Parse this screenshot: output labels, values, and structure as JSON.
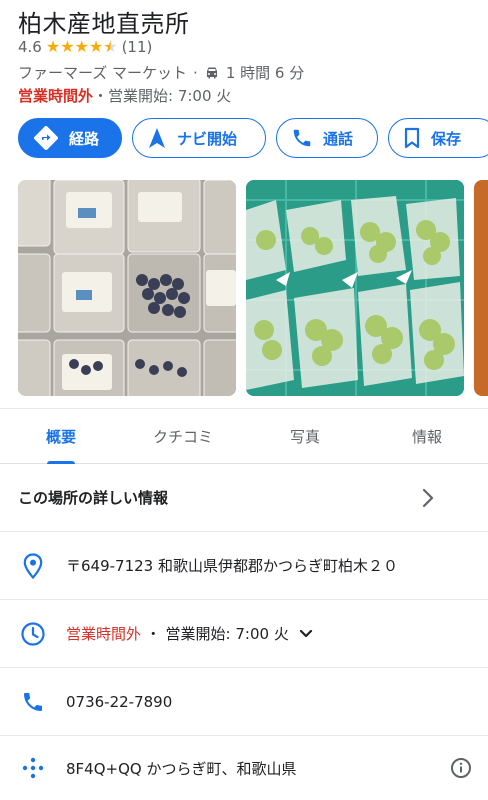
{
  "place": {
    "name": "柏木産地直売所",
    "rating": "4.6",
    "review_count": "(11)",
    "stars": 4.6,
    "category": "ファーマーズ マーケット",
    "drive_time": "1 時間 6 分",
    "status_closed": "営業時間外",
    "open_info": "・営業開始: 7:00 火"
  },
  "actions": {
    "route": "経路",
    "navigate": "ナビ開始",
    "call": "通話",
    "save": "保存"
  },
  "tabs": [
    "概要",
    "クチコミ",
    "写真",
    "情報"
  ],
  "details_label": "この場所の詳しい情報",
  "address": "〒649-7123 和歌山県伊都郡かつらぎ町柏木２０",
  "hours": {
    "closed": "営業時間外",
    "open_info": " ・ 営業開始: 7:00 火"
  },
  "phone": "0736-22-7890",
  "plus_code": "8F4Q+QQ かつらぎ町、和歌山県",
  "colors": {
    "accent": "#1a73e8",
    "closed": "#d93025",
    "star": "#f9ab00"
  }
}
